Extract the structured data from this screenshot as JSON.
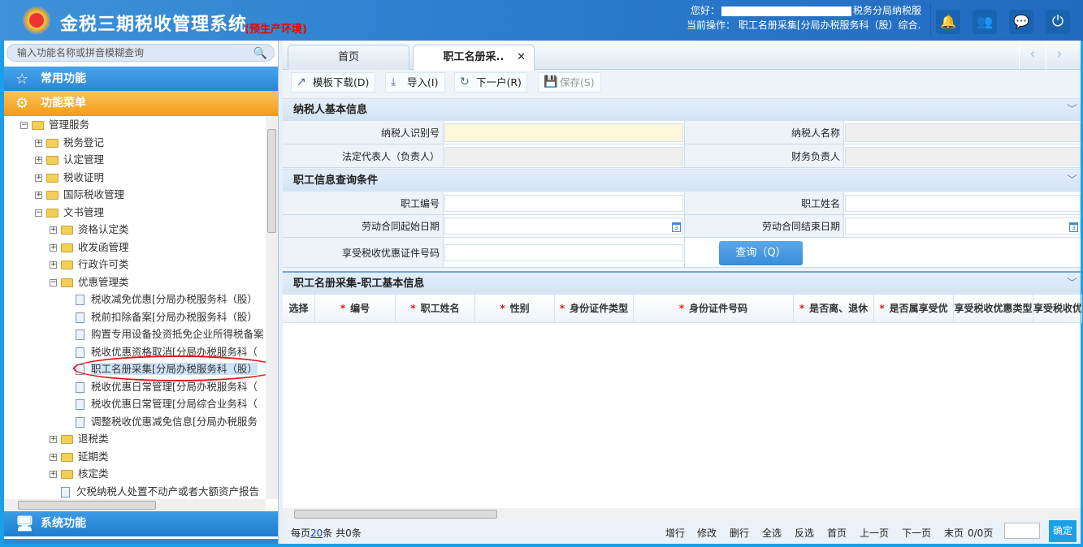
{
  "header": {
    "title": "金税三期税收管理系统",
    "env": "(预生产环境)",
    "greeting_prefix": "您好：",
    "greeting_suffix": "税务分局纳税服",
    "current_op": "当前操作： 职工名册采集[分局办税服务科（股）综合.",
    "icons": [
      "bell-icon",
      "users-icon",
      "chat-icon",
      "power-icon"
    ]
  },
  "sidebar": {
    "search_placeholder": "输入功能名称或拼音模糊查询",
    "common": "常用功能",
    "menu": "功能菜单",
    "system": "系统功能",
    "tree": [
      {
        "level": 0,
        "type": "folder",
        "open": true,
        "label": "管理服务"
      },
      {
        "level": 1,
        "type": "folder",
        "open": false,
        "label": "税务登记"
      },
      {
        "level": 1,
        "type": "folder",
        "open": false,
        "label": "认定管理"
      },
      {
        "level": 1,
        "type": "folder",
        "open": false,
        "label": "税收证明"
      },
      {
        "level": 1,
        "type": "folder",
        "open": false,
        "label": "国际税收管理"
      },
      {
        "level": 1,
        "type": "folder",
        "open": true,
        "label": "文书管理"
      },
      {
        "level": 2,
        "type": "folder",
        "open": false,
        "label": "资格认定类"
      },
      {
        "level": 2,
        "type": "folder",
        "open": false,
        "label": "收发函管理"
      },
      {
        "level": 2,
        "type": "folder",
        "open": false,
        "label": "行政许可类"
      },
      {
        "level": 2,
        "type": "folder",
        "open": true,
        "label": "优惠管理类"
      },
      {
        "level": 3,
        "type": "doc",
        "label": "税收减免优惠[分局办税服务科（股）"
      },
      {
        "level": 3,
        "type": "doc",
        "label": "税前扣除备案[分局办税服务科（股）"
      },
      {
        "level": 3,
        "type": "doc",
        "label": "购置专用设备投资抵免企业所得税备案"
      },
      {
        "level": 3,
        "type": "doc",
        "label": "税收优惠资格取消[分局办税服务科（"
      },
      {
        "level": 3,
        "type": "doc",
        "label": "职工名册采集[分局办税服务科（股）",
        "selected": true
      },
      {
        "level": 3,
        "type": "doc",
        "label": "税收优惠日常管理[分局办税服务科（"
      },
      {
        "level": 3,
        "type": "doc",
        "label": "税收优惠日常管理[分局综合业务科（"
      },
      {
        "level": 3,
        "type": "doc",
        "label": "调整税收优惠减免信息[分局办税服务"
      },
      {
        "level": 2,
        "type": "folder",
        "open": false,
        "label": "退税类"
      },
      {
        "level": 2,
        "type": "folder",
        "open": false,
        "label": "延期类"
      },
      {
        "level": 2,
        "type": "folder",
        "open": false,
        "label": "核定类"
      },
      {
        "level": 2,
        "type": "doc",
        "label": "欠税纳税人处置不动产或者大额资产报告"
      }
    ]
  },
  "tabs": [
    {
      "label": "首页"
    },
    {
      "label": "职工名册采..",
      "active": true
    }
  ],
  "toolbar": {
    "template": "模板下载(D)",
    "import": "导入(I)",
    "next": "下一户(R)",
    "save": "保存(S)"
  },
  "taxpayer": {
    "title": "纳税人基本信息",
    "id_label": "纳税人识别号",
    "name_label": "纳税人名称",
    "legal_label": "法定代表人（负责人）",
    "finance_label": "财务负责人"
  },
  "query": {
    "title": "职工信息查询条件",
    "emp_no": "职工编号",
    "emp_name": "职工姓名",
    "start_date": "劳动合同起始日期",
    "end_date": "劳动合同结束日期",
    "cert_no": "享受税收优惠证件号码",
    "button": "查询（Q）"
  },
  "grid": {
    "title": "职工名册采集-职工基本信息",
    "columns": [
      {
        "label": "选择",
        "req": false
      },
      {
        "label": "编号",
        "req": true
      },
      {
        "label": "职工姓名",
        "req": true
      },
      {
        "label": "性别",
        "req": true
      },
      {
        "label": "身份证件类型",
        "req": true
      },
      {
        "label": "身份证件号码",
        "req": true
      },
      {
        "label": "是否离、退休",
        "req": true
      },
      {
        "label": "是否属享受优",
        "req": true
      },
      {
        "label": "享受税收优惠类型",
        "req": false
      },
      {
        "label": "享受税收优",
        "req": false
      }
    ]
  },
  "pager": {
    "per_page_prefix": "每页",
    "per_page": "20",
    "per_page_suffix": "条 共0条",
    "add": "增行",
    "edit": "修改",
    "del": "删行",
    "all": "全选",
    "invert": "反选",
    "first": "首页",
    "prev": "上一页",
    "next": "下一页",
    "last": "末页",
    "pages": "0/0页",
    "go": "确定"
  },
  "colors": {
    "accent": "#1aa0e8",
    "menu_orange": "#f39b16",
    "required": "#e01818"
  }
}
